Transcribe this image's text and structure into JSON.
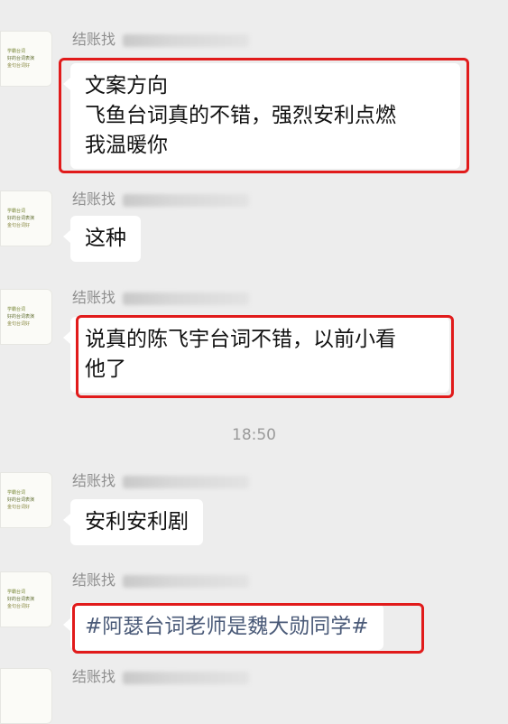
{
  "messages": [
    {
      "sender": "结账找",
      "avatar_lines": [
        "学霸台词",
        "好的台词表演",
        "金句台词好"
      ],
      "text": "文案方向\n飞鱼台词真的不错，强烈安利点燃\n我温暖你",
      "highlighted": true
    },
    {
      "sender": "结账找",
      "avatar_lines": [
        "学霸台词",
        "好的台词表演",
        "金句台词好"
      ],
      "text": "这种",
      "highlighted": false
    },
    {
      "sender": "结账找",
      "avatar_lines": [
        "学霸台词",
        "好的台词表演",
        "金句台词好"
      ],
      "text": "说真的陈飞宇台词不错，以前小看\n他了",
      "highlighted": true
    },
    {
      "sender": "结账找",
      "avatar_lines": [
        "学霸台词",
        "好的台词表演",
        "金句台词好"
      ],
      "text": "安利安利剧",
      "highlighted": false
    },
    {
      "sender": "结账找",
      "avatar_lines": [
        "学霸台词",
        "好的台词表演",
        "金句台词好"
      ],
      "text": "#阿瑟台词老师是魏大勋同学#",
      "highlighted": true
    },
    {
      "sender": "结账找",
      "avatar_lines": [],
      "text": "",
      "highlighted": false
    }
  ],
  "timestamp": "18:50",
  "colors": {
    "background": "#ededed",
    "bubble": "#ffffff",
    "highlight_border": "#e11b1b"
  }
}
